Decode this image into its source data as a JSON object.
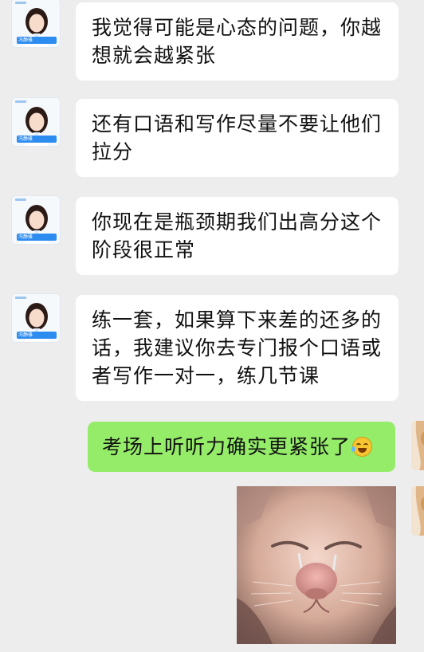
{
  "contact": {
    "avatar_label": "冯静雅",
    "avatar_icon": "teacher-portrait-icon"
  },
  "messages": [
    {
      "sender": "other",
      "lines": [
        "我觉得可能是心态的问题，你越",
        "想就会越紧张"
      ]
    },
    {
      "sender": "other",
      "lines": [
        "还有口语和写作尽量不要让他们",
        "拉分"
      ]
    },
    {
      "sender": "other",
      "lines": [
        "你现在是瓶颈期我们出高分这个",
        "阶段很正常"
      ]
    },
    {
      "sender": "other",
      "lines": [
        "练一套，如果算下来差的还多的",
        "话，我建议你去专门报个口语或",
        "者写作一对一，练几节课"
      ]
    },
    {
      "sender": "self",
      "lines": [
        "考场上听听力确实更紧张了"
      ],
      "emoji": "laughing-with-tears-icon"
    }
  ],
  "image_message": {
    "sender": "self",
    "content": "crying-cat-photo"
  },
  "colors": {
    "background": "#ededed",
    "incoming_bubble": "#ffffff",
    "outgoing_bubble": "#95ec69"
  }
}
